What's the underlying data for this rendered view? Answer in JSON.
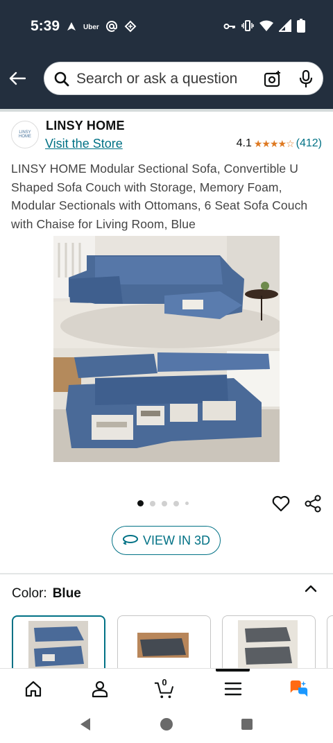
{
  "status_bar": {
    "time": "5:39",
    "uber_label": "Uber",
    "icons": [
      "navigation-icon",
      "uber-icon",
      "at-icon",
      "sync-icon",
      "key-icon",
      "vibrate-icon",
      "wifi-icon",
      "signal-icon",
      "battery-icon"
    ]
  },
  "search": {
    "placeholder": "Search or ask a question",
    "value": ""
  },
  "store": {
    "logo_text": "LINSY HOME",
    "name": "LINSY HOME",
    "link_label": "Visit the Store",
    "rating": "4.1",
    "stars": "★★★★☆",
    "rating_fraction": 0.82,
    "review_count": "(412)"
  },
  "product": {
    "title": "LINSY HOME Modular Sectional Sofa, Convertible U Shaped Sofa Couch with Storage, Memory Foam, Modular Sectionals with Ottomans, 6 Seat Sofa Couch with Chaise for Living Room, Blue",
    "image_count": 5,
    "active_image_index": 0,
    "view3d_label": "VIEW IN 3D"
  },
  "color": {
    "label": "Color:",
    "value": "Blue",
    "swatches": [
      "Blue",
      "Dark Grey",
      "Grey"
    ]
  },
  "bottom_nav": {
    "items": [
      "home-icon",
      "account-icon",
      "cart-icon",
      "menu-icon",
      "rufus-icon"
    ],
    "cart_count": "0",
    "active_item": "menu-icon"
  },
  "colors": {
    "header_bg": "#232f3e",
    "link": "#007185",
    "star": "#de7921",
    "rufus_orange": "#ff6a13",
    "rufus_blue": "#1a98ff"
  }
}
